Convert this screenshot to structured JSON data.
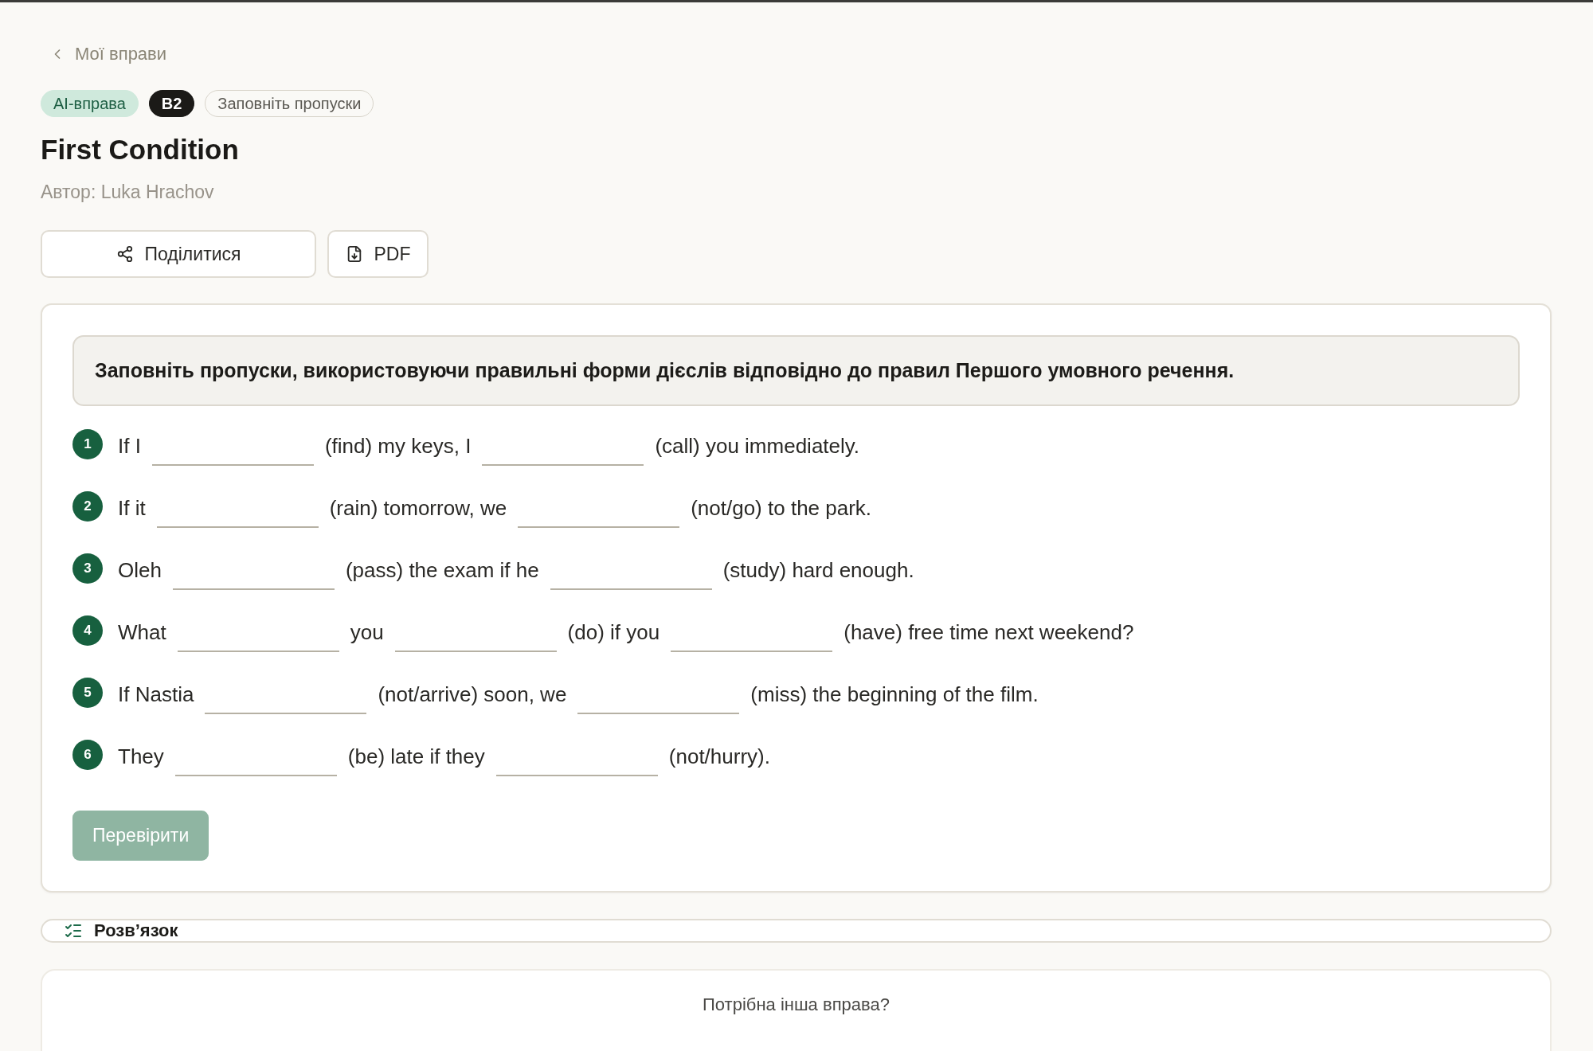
{
  "back_link": {
    "label": "Мої вправи"
  },
  "badges": [
    {
      "kind": "ai",
      "label": "AI-вправа"
    },
    {
      "kind": "level",
      "label": "B2"
    },
    {
      "kind": "format",
      "label": "Заповніть пропуски"
    }
  ],
  "title": "First Condition",
  "author": "Автор: Luka Hrachov",
  "actions": [
    {
      "kind": "share",
      "label": "Поділитися"
    },
    {
      "kind": "pdf",
      "label": "PDF"
    }
  ],
  "exercise": {
    "instruction": "Заповніть пропуски, використовуючи правильні форми дієслів відповідно до правил Першого умовного речення.",
    "questions": [
      {
        "number": "1",
        "parts": [
          {
            "kind": "text",
            "text": "If I"
          },
          {
            "kind": "blank"
          },
          {
            "kind": "text",
            "text": "(find) my keys, I"
          },
          {
            "kind": "blank"
          },
          {
            "kind": "text",
            "text": "(call) you immediately."
          }
        ]
      },
      {
        "number": "2",
        "parts": [
          {
            "kind": "text",
            "text": "If it"
          },
          {
            "kind": "blank"
          },
          {
            "kind": "text",
            "text": "(rain) tomorrow, we"
          },
          {
            "kind": "blank"
          },
          {
            "kind": "text",
            "text": "(not/go) to the park."
          }
        ]
      },
      {
        "number": "3",
        "parts": [
          {
            "kind": "text",
            "text": "Oleh"
          },
          {
            "kind": "blank"
          },
          {
            "kind": "text",
            "text": "(pass) the exam if he"
          },
          {
            "kind": "blank"
          },
          {
            "kind": "text",
            "text": "(study) hard enough."
          }
        ]
      },
      {
        "number": "4",
        "parts": [
          {
            "kind": "text",
            "text": "What"
          },
          {
            "kind": "blank"
          },
          {
            "kind": "text",
            "text": "you"
          },
          {
            "kind": "blank"
          },
          {
            "kind": "text",
            "text": "(do) if you"
          },
          {
            "kind": "blank"
          },
          {
            "kind": "text",
            "text": "(have) free time next weekend?"
          }
        ]
      },
      {
        "number": "5",
        "parts": [
          {
            "kind": "text",
            "text": "If Nastia"
          },
          {
            "kind": "blank"
          },
          {
            "kind": "text",
            "text": "(not/arrive) soon, we"
          },
          {
            "kind": "blank"
          },
          {
            "kind": "text",
            "text": "(miss) the beginning of the film."
          }
        ]
      },
      {
        "number": "6",
        "parts": [
          {
            "kind": "text",
            "text": "They"
          },
          {
            "kind": "blank"
          },
          {
            "kind": "text",
            "text": "(be) late if they"
          },
          {
            "kind": "blank"
          },
          {
            "kind": "text",
            "text": "(not/hurry)."
          }
        ]
      }
    ],
    "check_button": {
      "label": "Перевірити",
      "disabled": true
    }
  },
  "solution": {
    "label": "Розв’язок"
  },
  "more": {
    "prompt": "Потрібна інша вправа?"
  }
}
